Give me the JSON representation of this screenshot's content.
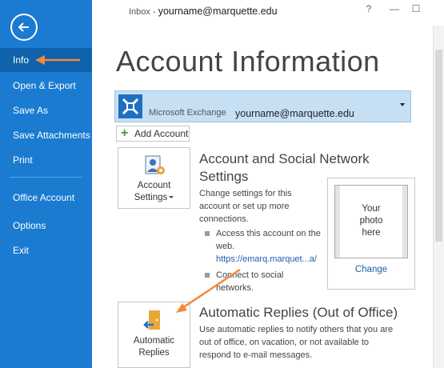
{
  "colors": {
    "sidebar": "#1a7bd1",
    "sidebar_active": "#0f62ab",
    "accent_arrow": "#f08a3c",
    "account_bar": "#c6dff3",
    "link": "#1f5fa8"
  },
  "sidebar": {
    "back_icon": "back-arrow-icon",
    "items": [
      {
        "label": "Info"
      },
      {
        "label": "Open & Export"
      },
      {
        "label": "Save As"
      },
      {
        "label": "Save Attachments"
      },
      {
        "label": "Print"
      },
      {
        "label": "Office Account"
      },
      {
        "label": "Options"
      },
      {
        "label": "Exit"
      }
    ]
  },
  "titlebar": {
    "prefix": "Inbox - ",
    "email": "yourname@marquette.edu",
    "help": "?",
    "minimize": "—",
    "maximize": "☐"
  },
  "main": {
    "title": "Account Information",
    "account": {
      "type": "Microsoft Exchange",
      "email": "yourname@marquette.edu"
    },
    "add_account": "Add Account",
    "account_settings": {
      "button_line1": "Account",
      "button_line2": "Settings",
      "title_line1": "Account and Social Network",
      "title_line2": "Settings",
      "desc_line1": "Change settings for this",
      "desc_line2": "account or set up more",
      "desc_line3": "connections.",
      "bullet1_line1": "Access this account on the",
      "bullet1_line2": "web.",
      "link": "https://emarq.marquet...a/",
      "bullet2_line1": "Connect to social",
      "bullet2_line2": "networks."
    },
    "photo": {
      "placeholder": "Your\nphoto\nhere",
      "change": "Change"
    },
    "automatic_replies": {
      "button_line1": "Automatic",
      "button_line2": "Replies",
      "title": "Automatic Replies (Out of Office)",
      "desc_line1": "Use automatic replies to notify others that you are",
      "desc_line2": "out of office, on vacation, or not available to",
      "desc_line3": "respond to e-mail messages."
    }
  }
}
